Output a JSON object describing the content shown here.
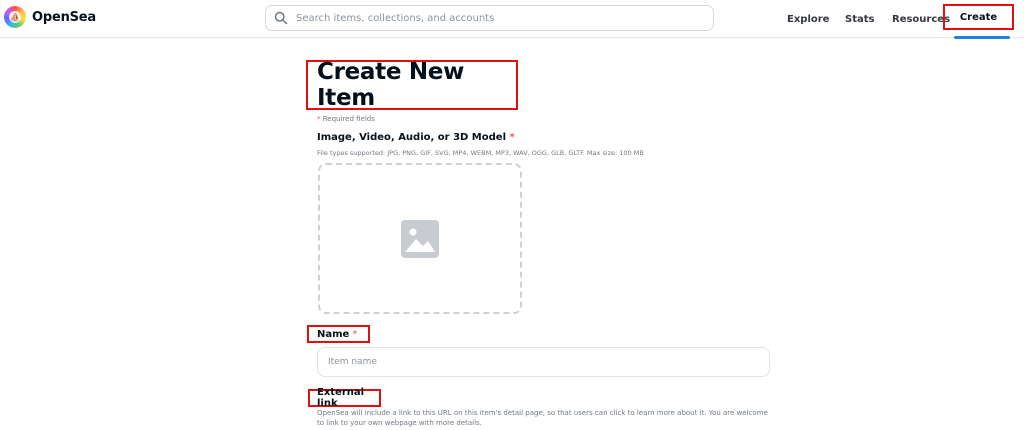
{
  "header": {
    "logo_text": "OpenSea",
    "search_placeholder": "Search items, collections, and accounts",
    "nav": {
      "explore": "Explore",
      "stats": "Stats",
      "resources": "Resources",
      "create": "Create"
    }
  },
  "main": {
    "title": "Create New Item",
    "required_star": "*",
    "required_text": "Required fields",
    "media": {
      "label": "Image, Video, Audio, or 3D Model",
      "star": "*",
      "file_types": "File types supported: JPG, PNG, GIF, SVG, MP4, WEBM, MP3, WAV, OGG, GLB, GLTF. Max size: 100 MB",
      "icon": "image-icon"
    },
    "name": {
      "label": "Name",
      "star": "*",
      "placeholder": "Item name",
      "value": ""
    },
    "external_link": {
      "label": "External link",
      "description": "OpenSea will include a link to this URL on this item's detail page, so that users can click to learn more about it. You are welcome to link to your own webpage with more details."
    }
  },
  "colors": {
    "highlight_border": "#e01010",
    "accent": "#2081e2",
    "required_star": "#eb5757"
  }
}
